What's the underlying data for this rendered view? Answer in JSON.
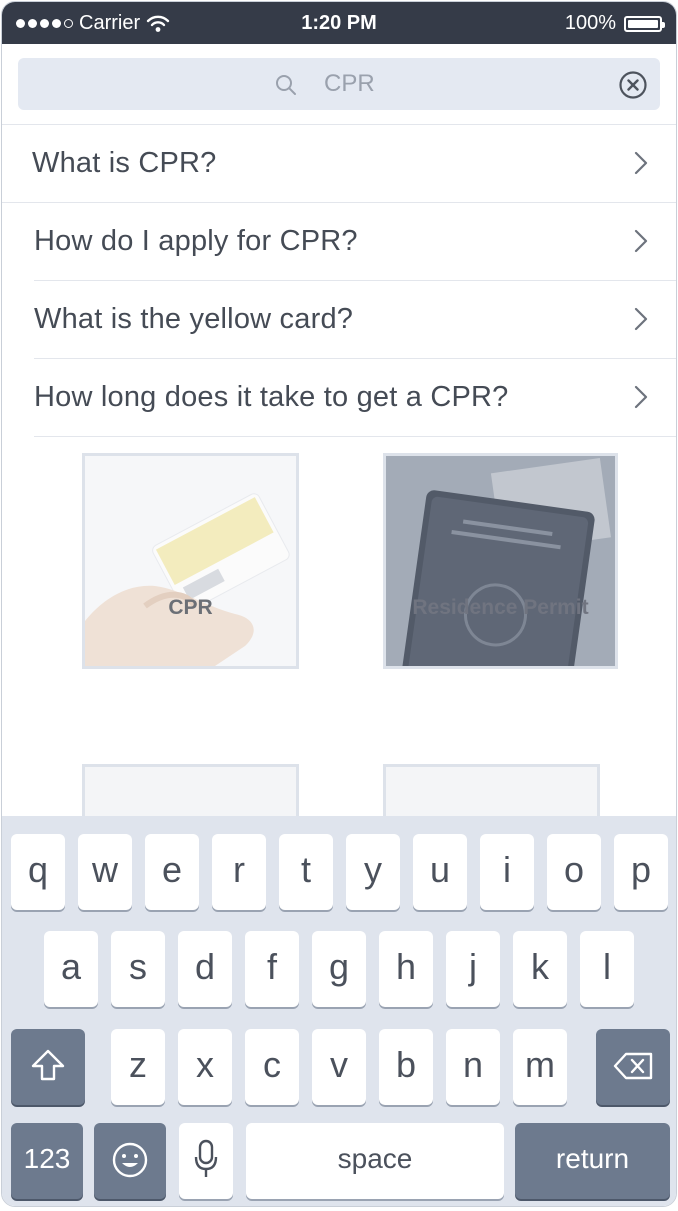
{
  "status_bar": {
    "carrier": "Carrier",
    "time": "1:20 PM",
    "battery": "100%"
  },
  "search": {
    "value": "CPR"
  },
  "results": [
    {
      "question": "What is CPR?"
    },
    {
      "question": "How do I apply for CPR?"
    },
    {
      "question": "What is the yellow card?"
    },
    {
      "question": "How long does it take to get a CPR?"
    }
  ],
  "tiles": [
    {
      "label": "CPR"
    },
    {
      "label": "Residence Permit"
    }
  ],
  "keyboard": {
    "row1": [
      "q",
      "w",
      "e",
      "r",
      "t",
      "y",
      "u",
      "i",
      "o",
      "p"
    ],
    "row2": [
      "a",
      "s",
      "d",
      "f",
      "g",
      "h",
      "j",
      "k",
      "l"
    ],
    "row3": [
      "z",
      "x",
      "c",
      "v",
      "b",
      "n",
      "m"
    ],
    "numbers_label": "123",
    "space_label": "space",
    "return_label": "return"
  },
  "colors": {
    "status_bar": "#353b48",
    "keyboard_bg": "#dfe4ed",
    "dark_key": "#6d7a8e",
    "search_bg": "#e4e9f2"
  }
}
